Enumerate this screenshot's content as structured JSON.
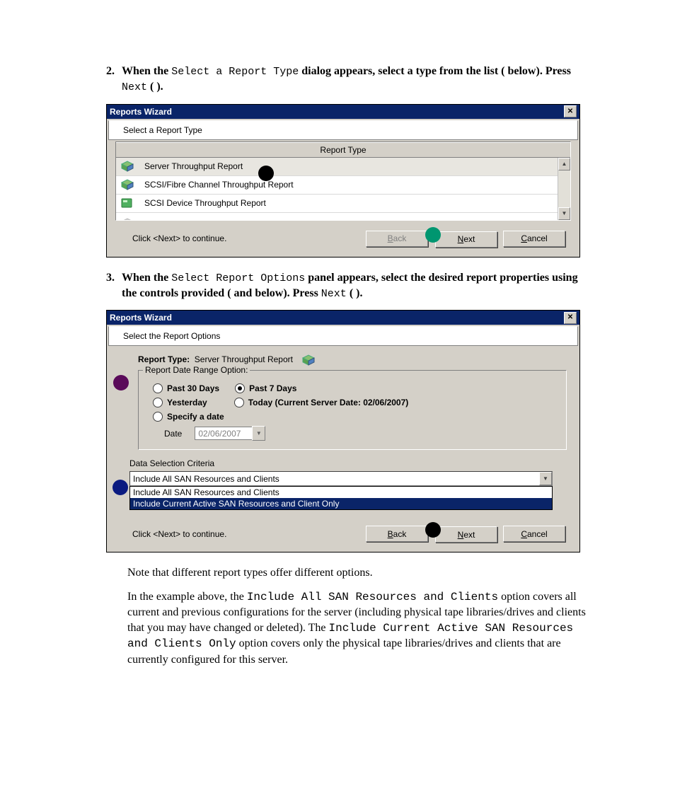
{
  "step2": {
    "num": "2.",
    "prefix_bold": "When the ",
    "mono1": "Select a Report Type",
    "middle_bold": " dialog appears, select a type from the list (   below). Press ",
    "mono2": "Next",
    "suffix_bold": " (   )."
  },
  "step3": {
    "num": "3.",
    "prefix_bold": "When the ",
    "mono1": "Select Report Options",
    "middle_bold": " panel appears, select the desired report properties using the controls provided (    and    below). Press ",
    "mono2": "Next",
    "suffix_bold": " (   )."
  },
  "dialog1": {
    "title": "Reports Wizard",
    "subtitle": "Select a Report Type",
    "col_header": "Report Type",
    "items": [
      "Server Throughput Report",
      "SCSI/Fibre Channel Throughput Report",
      "SCSI Device Throughput Report"
    ],
    "hint": "Click <Next> to continue.",
    "back": "Back",
    "next": "Next",
    "cancel": "Cancel"
  },
  "dialog2": {
    "title": "Reports Wizard",
    "subtitle": "Select the Report Options",
    "rtype_label": "Report Type:",
    "rtype_value": "Server Throughput Report",
    "range_legend": "Report Date Range Option:",
    "radios": {
      "past30": "Past 30 Days",
      "past7": "Past 7 Days",
      "yesterday": "Yesterday",
      "today": "Today (Current Server Date: 02/06/2007)",
      "specify": "Specify a date"
    },
    "date_label": "Date",
    "date_value": "02/06/2007",
    "dsc_label": "Data Selection Criteria",
    "combo_value": "Include All SAN Resources and Clients",
    "combo_items": [
      "Include All SAN Resources and Clients",
      "Include Current Active SAN Resources and Client Only"
    ],
    "hint": "Click <Next> to continue.",
    "back": "Back",
    "next": "Next",
    "cancel": "Cancel"
  },
  "notes": {
    "p1": "Note that different report types offer different options.",
    "p2a": "In the example above, the ",
    "p2m1": "Include All SAN Resources and Clients",
    "p2b": " option covers all current and previous configurations for the server (including physical tape libraries/drives and clients that you may have changed or deleted). The ",
    "p2m2": "Include Current Active SAN Resources and Clients Only",
    "p2c": " option covers only the physical tape libraries/drives and clients that are currently configured for this server."
  }
}
